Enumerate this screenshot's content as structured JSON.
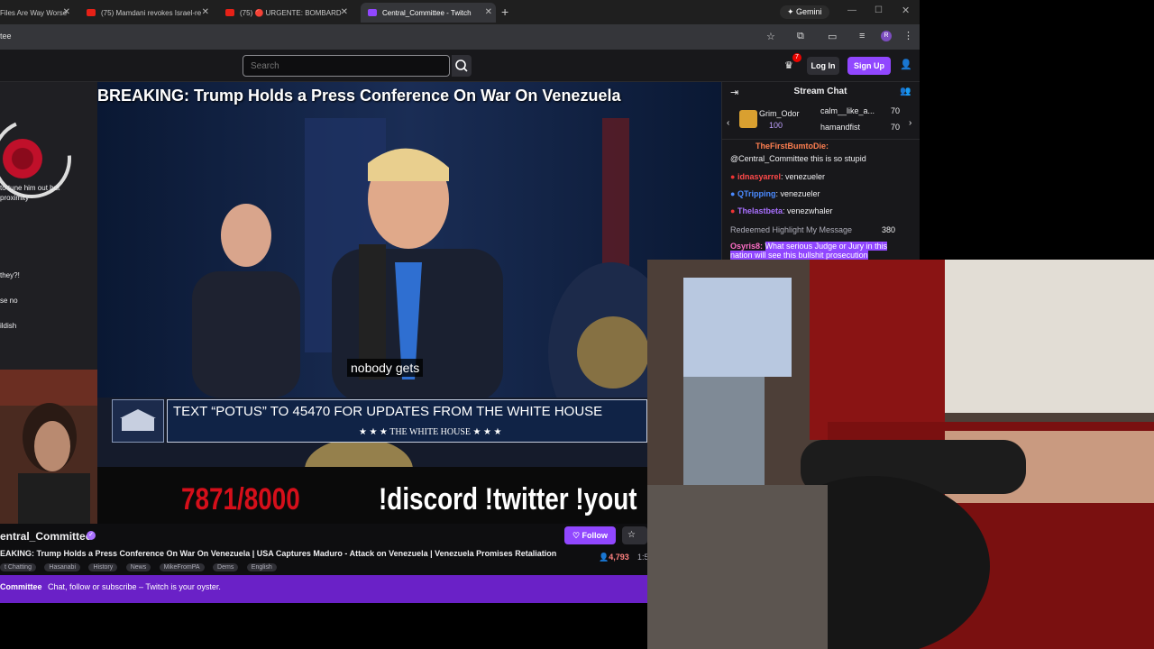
{
  "browser": {
    "tabs": [
      {
        "label": "Files Are Way Worse",
        "active": false
      },
      {
        "label": "(75) Mamdani revokes Israel-re",
        "active": false
      },
      {
        "label": "(75) 🔴 URGENTE: BOMBARD",
        "active": false
      },
      {
        "label": "Central_Committee - Twitch",
        "active": true
      }
    ],
    "gemini_label": "Gemini",
    "address_fragment": "tee"
  },
  "nav": {
    "search_placeholder": "Search",
    "notif_count": "7",
    "login_label": "Log In",
    "signup_label": "Sign Up"
  },
  "sidebar": {
    "rows": [
      "to tune him out but",
      "proximity",
      "they?!",
      "se no",
      "ildish"
    ]
  },
  "video": {
    "headline": "BREAKING: Trump Holds a Press Conference On War On Venezuela",
    "caption": "nobody gets",
    "wh_text": "TEXT “POTUS” TO 45470 FOR UPDATES FROM THE WHITE HOUSE",
    "wh_sub": "★ ★ ★   THE WHITE HOUSE   ★ ★ ★",
    "counter": "7871/8000",
    "social": "!discord !twitter !yout"
  },
  "channel": {
    "name": "entral_Committee",
    "follow_label": "Follow",
    "stream_title": "EAKING: Trump Holds a Press Conference On War On Venezuela | USA Captures Maduro - Attack on Venezuela | Venezuela Promises Retaliation",
    "viewers": "4,793",
    "uptime": "1:5",
    "tags": [
      "t Chatting",
      "Hasanabi",
      "History",
      "News",
      "MikeFromPA",
      "Dems",
      "English"
    ]
  },
  "promo": {
    "name": "Committee",
    "text": "Chat, follow or subscribe – Twitch is your oyster."
  },
  "chat": {
    "title": "Stream Chat",
    "leaderboard": [
      {
        "name": "Grim_Odor",
        "value": "100"
      },
      {
        "name": "calm__like_a...",
        "value": "70"
      },
      {
        "name": "hamandfist",
        "value": "70"
      }
    ],
    "messages": [
      {
        "user": "TheFirstBumtoDie:",
        "text": "",
        "color": "#ff7f50"
      },
      {
        "user": "",
        "text": "@Central_Committee this is so stupid",
        "color": "#efeff1"
      },
      {
        "user": "idnasyarrel",
        "text": ": venezueler",
        "color": "#ff4a4a"
      },
      {
        "user": "QTripping",
        "text": ": venezueler",
        "color": "#4a8aff"
      },
      {
        "user": "Thelastbeta",
        "text": ": venezwhaler",
        "color": "#a970ff"
      }
    ],
    "redeem_label": "Redeemed Highlight My Message",
    "redeem_cost": "380",
    "highlight_user": "Osyris8:",
    "highlight_text": "What serious Judge or Jury in this nation will see this bullshit prosecution"
  },
  "colors": {
    "twitch_purple": "#9147ff",
    "promo_purple": "#6a21c7",
    "bg_dark": "#18181b"
  }
}
